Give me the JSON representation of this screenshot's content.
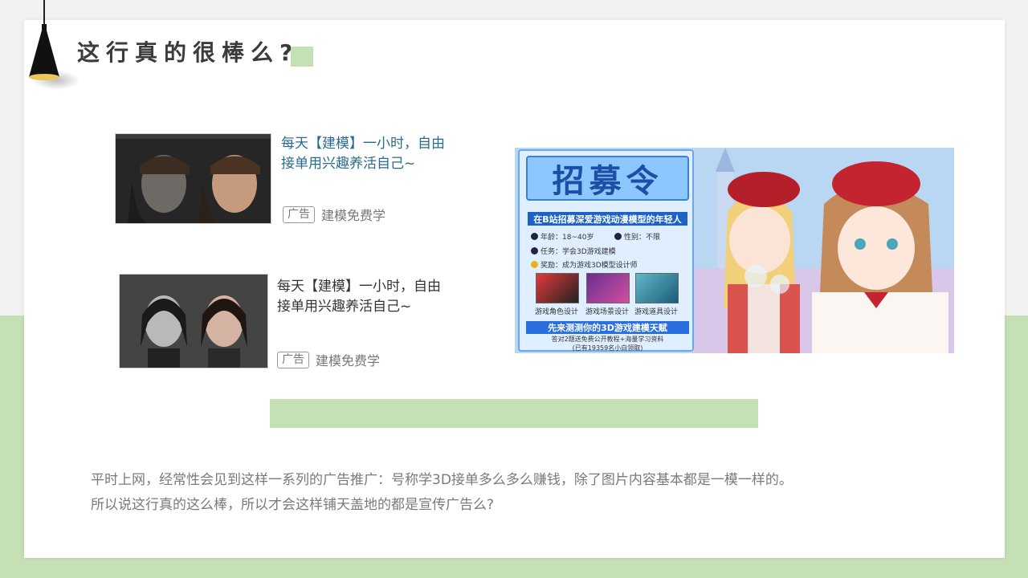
{
  "colors": {
    "accent_green": "#c5e0b4",
    "title_color": "#3b3b3b",
    "ad_title_blue": "#2a6a8f",
    "ad_title_dark": "#333333",
    "body_text": "#7a7a7a"
  },
  "slide": {
    "title": "这行真的很棒么?",
    "ads": [
      {
        "headline_line1": "每天【建模】一小时，自由",
        "headline_line2": "接单用兴趣养活自己~",
        "tag": "广告",
        "advertiser": "建模免费学"
      },
      {
        "headline_line1": "每天【建模】一小时，自由",
        "headline_line2": "接单用兴趣养活自己~",
        "tag": "广告",
        "advertiser": "建模免费学"
      }
    ],
    "banner": {
      "title": "招募令",
      "subhead": "在B站招募深爱游戏动漫模型的年轻人",
      "age": "年龄：18~40岁",
      "gender": "性别：不限",
      "task": "任务：学会3D游戏建模",
      "reward": "奖励：成为游戏3D模型设计师",
      "thumb_labels": [
        "游戏角色设计",
        "游戏场景设计",
        "游戏道具设计"
      ],
      "cta": "先来测测你的3D游戏建模天赋",
      "footer_line1": "答对2题送免费公开教程+海量学习资料",
      "footer_line2": "(已有19359名小白领取)"
    },
    "body_line1": "平时上网，经常性会见到这样一系列的广告推广：号称学3D接单多么多么赚钱，除了图片内容基本都是一模一样的。",
    "body_line2": "所以说这行真的这么棒，所以才会这样铺天盖地的都是宣传广告么?"
  }
}
